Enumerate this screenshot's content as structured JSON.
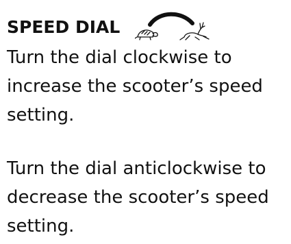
{
  "section": {
    "heading": "SPEED DIAL",
    "icons": {
      "slow": "tortoise-icon",
      "fast": "hare-icon",
      "arc": "clockwise-arc-icon"
    },
    "paragraphs": [
      "Turn the dial clockwise to increase the scooter’s speed setting.",
      "Turn the dial anticlockwise to decrease the scooter’s speed setting."
    ]
  },
  "colors": {
    "text": "#111111",
    "background": "#ffffff"
  }
}
